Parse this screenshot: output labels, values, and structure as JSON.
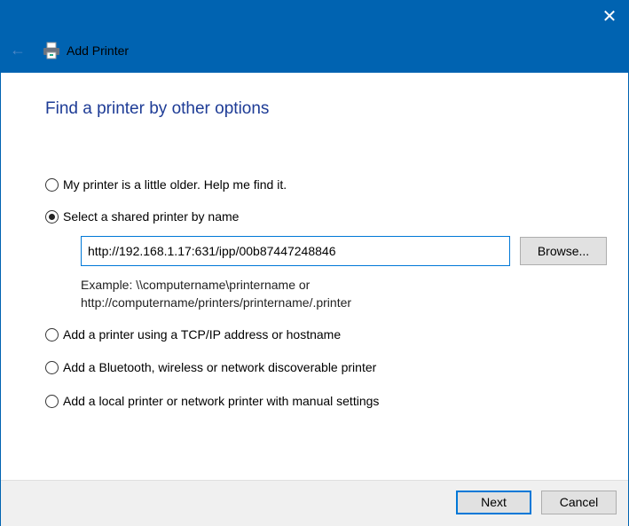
{
  "window": {
    "title": "Add Printer",
    "close_icon": "close-icon",
    "back_icon": "back-arrow-icon",
    "printer_icon": "printer-icon"
  },
  "main": {
    "heading": "Find a printer by other options",
    "options": [
      {
        "label": "My printer is a little older. Help me find it.",
        "selected": false
      },
      {
        "label": "Select a shared printer by name",
        "selected": true
      },
      {
        "label": "Add a printer using a TCP/IP address or hostname",
        "selected": false
      },
      {
        "label": "Add a Bluetooth, wireless or network discoverable printer",
        "selected": false
      },
      {
        "label": "Add a local printer or network printer with manual settings",
        "selected": false
      }
    ],
    "printer_name_value": "http://192.168.1.17:631/ipp/00b87447248846",
    "browse_label": "Browse...",
    "example_line1": "Example: \\\\computername\\printername or",
    "example_line2": "http://computername/printers/printername/.printer"
  },
  "footer": {
    "next_label": "Next",
    "cancel_label": "Cancel"
  }
}
